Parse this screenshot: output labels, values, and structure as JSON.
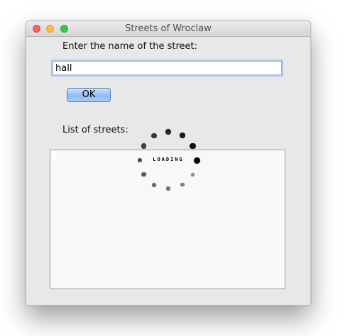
{
  "window": {
    "title": "Streets of Wroclaw",
    "buttons": [
      "close",
      "minimize",
      "zoom"
    ]
  },
  "form": {
    "street_label": "Enter the name of the street:",
    "street_value": "hall",
    "ok_label": "OK",
    "list_label": "List of streets:",
    "streets": []
  },
  "spinner": {
    "text": "LOADING",
    "dot_count": 12,
    "head_color": "#000000",
    "tail_color": "#888888"
  },
  "colors": {
    "window_bg": "#e8e8e8",
    "button_accent": "#8fbaf3",
    "focus_ring": "#a9c8ef"
  }
}
